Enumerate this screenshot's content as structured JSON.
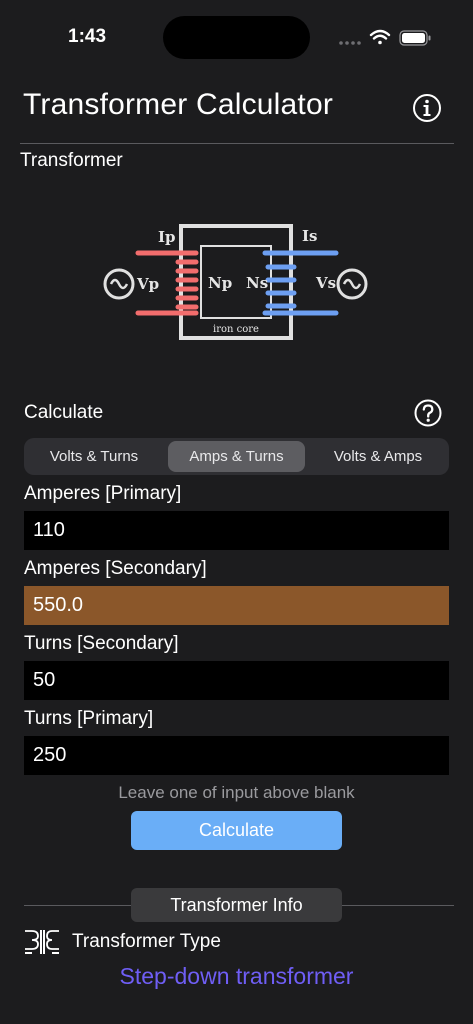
{
  "status_bar": {
    "time": "1:43"
  },
  "header": {
    "title": "Transformer Calculator",
    "info_icon": "info-circle-icon"
  },
  "diagram": {
    "section_label": "Transformer",
    "labels": {
      "ip": "Ip",
      "is": "Is",
      "vp": "Vp",
      "vs": "Vs",
      "np": "Np",
      "ns": "Ns",
      "core": "iron core"
    },
    "colors": {
      "primary": "#f26d6d",
      "secondary": "#6d9ff2",
      "core": "#e6e6e6"
    }
  },
  "calculate": {
    "section_label": "Calculate",
    "help_icon": "question-circle-icon",
    "modes": [
      "Volts & Turns",
      "Amps & Turns",
      "Volts & Amps"
    ],
    "active_mode": "Amps & Turns"
  },
  "fields": [
    {
      "label": "Amperes [Primary]",
      "value": "110"
    },
    {
      "label": "Amperes [Secondary]",
      "value": "550.0"
    },
    {
      "label": "Turns [Secondary]",
      "value": "50"
    },
    {
      "label": "Turns [Primary]",
      "value": "250"
    }
  ],
  "hint": "Leave one of input above blank",
  "calculate_button": "Calculate",
  "info": {
    "badge": "Transformer Info",
    "type_label": "Transformer Type",
    "type_value": "Step-down transformer",
    "type_icon": "transformer-symbol-icon"
  }
}
